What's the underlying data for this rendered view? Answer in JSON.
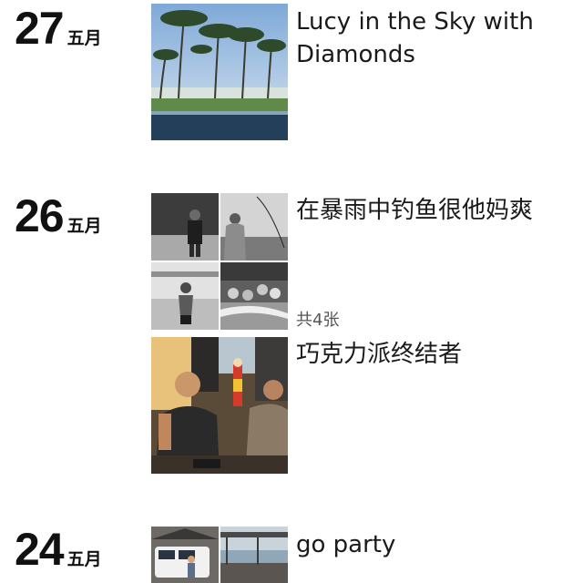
{
  "entries": [
    {
      "day": "27",
      "month": "五月",
      "caption": "Lucy in the Sky with Diamonds",
      "photos": [
        "palm-beach-photo"
      ]
    },
    {
      "day": "26",
      "month": "五月",
      "caption": "在暴雨中钓鱼很他妈爽",
      "photo_count": "共4张",
      "photos": [
        "man-by-hedge-photo",
        "fishing-photo",
        "man-in-water-photo",
        "group-in-pond-photo"
      ]
    },
    {
      "day": "",
      "month": "",
      "caption": "巧克力派终结者",
      "photos": [
        "restaurant-photo"
      ]
    },
    {
      "day": "24",
      "month": "五月",
      "caption": "go party",
      "photos": [
        "van-photo",
        "rooftop-photo"
      ]
    }
  ]
}
